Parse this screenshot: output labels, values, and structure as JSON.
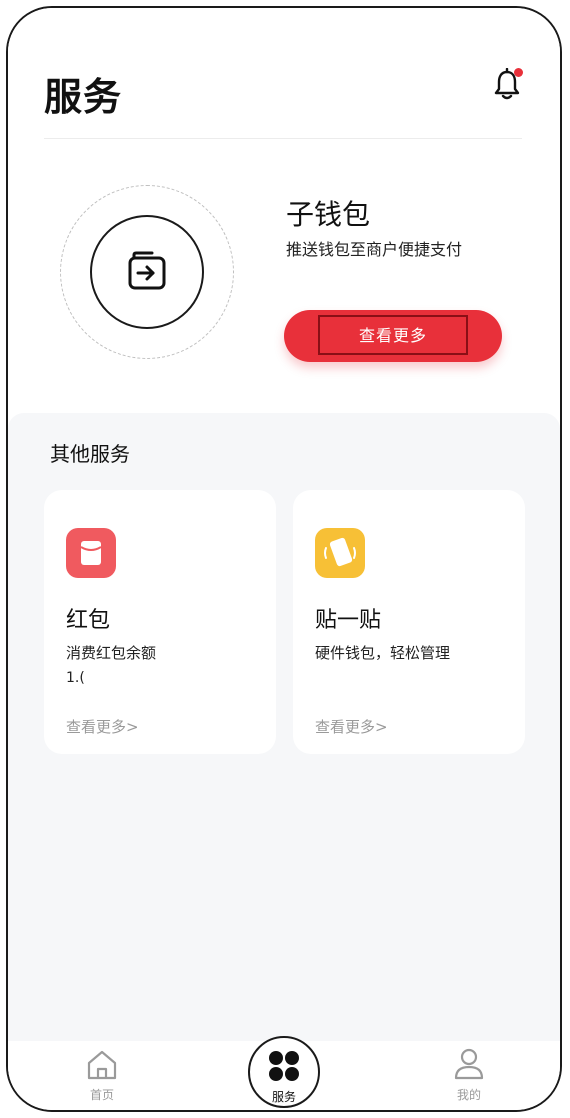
{
  "header": {
    "title": "服务",
    "notification_icon": "bell-icon",
    "notification_dot_color": "#e8303a"
  },
  "hero": {
    "icon": "wallet-transfer-icon",
    "title": "子钱包",
    "subtitle": "推送钱包至商户便捷支付",
    "button_label": "查看更多",
    "button_color": "#e8303a"
  },
  "other_services": {
    "title": "其他服务",
    "cards": [
      {
        "icon": "red-packet-icon",
        "icon_color": "#f05a5f",
        "title": "红包",
        "desc": "消费红包余额",
        "extra": "1.(",
        "link": "查看更多>"
      },
      {
        "icon": "tap-card-icon",
        "icon_color": "#f7c036",
        "title": "贴一贴",
        "desc": "硬件钱包，轻松管理",
        "extra": "",
        "link": "查看更多>"
      }
    ]
  },
  "tabbar": {
    "items": [
      {
        "label": "首页",
        "icon": "home-icon"
      },
      {
        "label": "服务",
        "icon": "services-grid-icon"
      },
      {
        "label": "我的",
        "icon": "user-icon"
      }
    ]
  }
}
